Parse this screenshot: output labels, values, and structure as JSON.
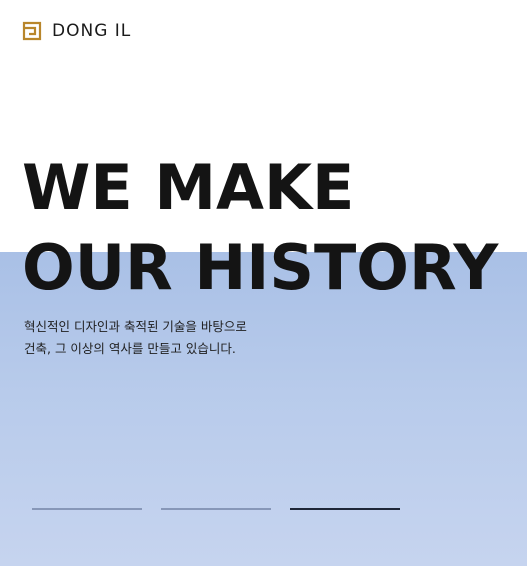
{
  "header": {
    "brand": "DONG IL",
    "logo_icon": "dong-il-logo-mark",
    "logo_color": "#b8862b"
  },
  "hero": {
    "headline_line1": "WE MAKE",
    "headline_line2": "OUR HISTORY",
    "subtext_line1": "혁신적인 디자인과 축적된 기술을 바탕으로",
    "subtext_line2": "건축, 그 이상의 역사를 만들고 있습니다.",
    "background_color": "#b3c7ea",
    "slide_count": 3,
    "active_slide": 3
  }
}
